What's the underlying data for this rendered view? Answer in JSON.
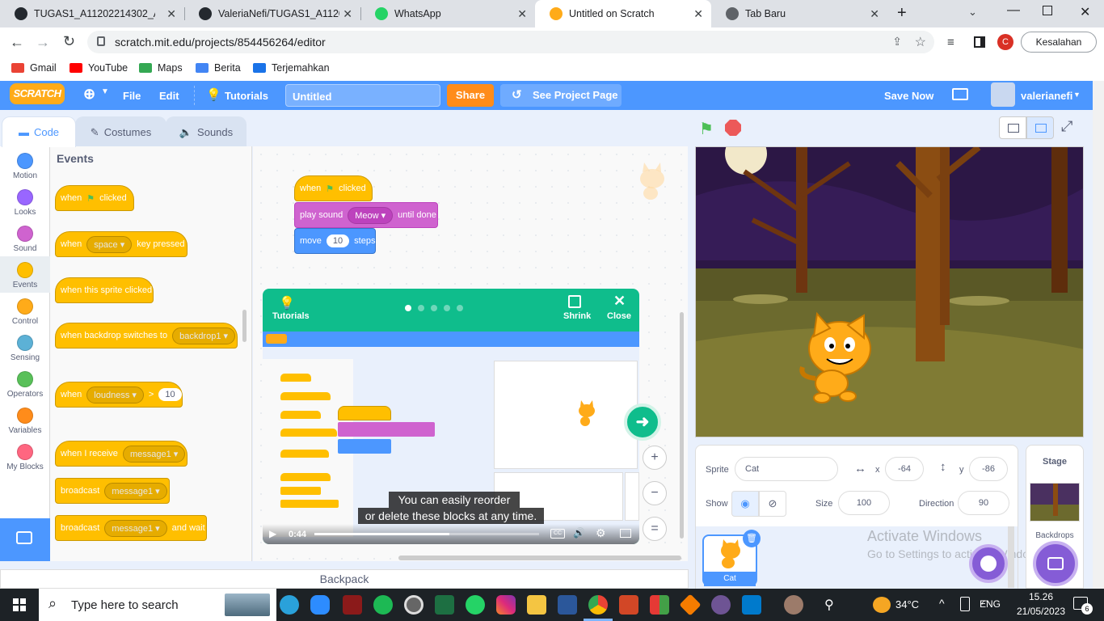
{
  "browser": {
    "tabs": [
      {
        "title": "TUGAS1_A11202214302_A11"
      },
      {
        "title": "ValeriaNefi/TUGAS1_A11202"
      },
      {
        "title": "WhatsApp"
      },
      {
        "title": "Untitled on Scratch"
      },
      {
        "title": "Tab Baru"
      }
    ],
    "url": "scratch.mit.edu/projects/854456264/editor",
    "profile_initial": "C",
    "profile_label": "Kesalahan",
    "bookmarks": [
      "Gmail",
      "YouTube",
      "Maps",
      "Berita",
      "Terjemahkan"
    ]
  },
  "scratch": {
    "logo": "SCRATCH",
    "menu": {
      "file": "File",
      "edit": "Edit",
      "tutorials": "Tutorials",
      "project_title": "Untitled",
      "share": "Share",
      "see_project": "See Project Page",
      "save_now": "Save Now",
      "username": "valerianefi"
    },
    "tabs": {
      "code": "Code",
      "costumes": "Costumes",
      "sounds": "Sounds"
    },
    "categories": [
      {
        "label": "Motion",
        "color": "#4c97ff"
      },
      {
        "label": "Looks",
        "color": "#9966ff"
      },
      {
        "label": "Sound",
        "color": "#cf63cf"
      },
      {
        "label": "Events",
        "color": "#ffbf00"
      },
      {
        "label": "Control",
        "color": "#ffab19"
      },
      {
        "label": "Sensing",
        "color": "#5cb1d6"
      },
      {
        "label": "Operators",
        "color": "#59c059"
      },
      {
        "label": "Variables",
        "color": "#ff8c1a"
      },
      {
        "label": "My Blocks",
        "color": "#ff6680"
      }
    ],
    "palette": {
      "heading": "Events",
      "when": "when",
      "clicked": "clicked",
      "space": "space",
      "key_pressed": "key pressed",
      "sprite_clicked": "when this sprite clicked",
      "backdrop_switches": "when backdrop switches to",
      "backdrop1": "backdrop1",
      "loudness": "loudness",
      "gt": ">",
      "loud_value": "10",
      "receive": "when I receive",
      "message1": "message1",
      "broadcast": "broadcast",
      "and_wait": "and wait"
    },
    "script": {
      "when": "when",
      "clicked": "clicked",
      "play_sound": "play sound",
      "sound_name": "Meow",
      "until_done": "until done",
      "move": "move",
      "steps_value": "10",
      "steps": "steps"
    },
    "tutorial": {
      "label": "Tutorials",
      "shrink": "Shrink",
      "close": "Close",
      "caption_line1": "You can easily reorder",
      "caption_line2": "or delete these blocks at any time.",
      "time": "0:44",
      "progress": 0.6
    },
    "sprite_info": {
      "sprite_label": "Sprite",
      "sprite_name": "Cat",
      "x_label": "x",
      "x": "-64",
      "y_label": "y",
      "y": "-86",
      "show_label": "Show",
      "size_label": "Size",
      "size": "100",
      "direction_label": "Direction",
      "direction": "90",
      "sprite_tile": "Cat"
    },
    "stage_panel": {
      "title": "Stage",
      "backdrops": "Backdrops"
    },
    "backpack": "Backpack",
    "watermark_line1": "Activate Windows",
    "watermark_line2": "Go to Settings to activate Windows."
  },
  "taskbar": {
    "search_placeholder": "Type here to search",
    "temperature": "34°C",
    "language": "ENG",
    "time": "15.26",
    "date": "21/05/2023",
    "notifications": "6"
  }
}
